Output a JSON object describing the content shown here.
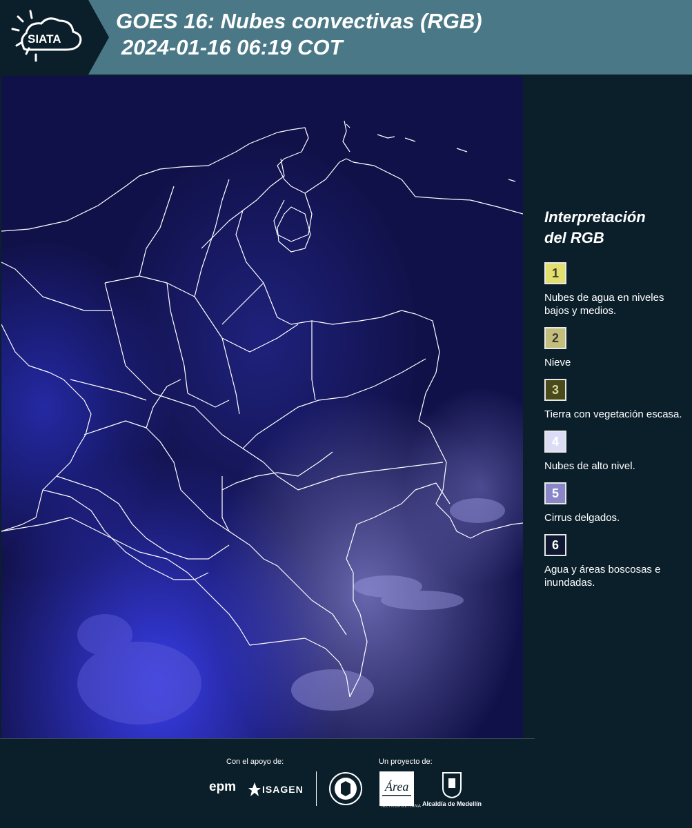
{
  "header": {
    "logo_text": "SIATA",
    "title_line1": "GOES 16: Nubes convectivas (RGB)",
    "title_line2": "2024-01-16 06:19 COT"
  },
  "legend": {
    "title_line1": "Interpretación",
    "title_line2": "del RGB",
    "items": [
      {
        "number": "1",
        "label": "Nubes de agua en niveles bajos y medios.",
        "color": "#e2df6c"
      },
      {
        "number": "2",
        "label": "Nieve",
        "color": "#c3bf7a"
      },
      {
        "number": "3",
        "label": "Tierra con vegetación escasa.",
        "color": "#4b4a1a"
      },
      {
        "number": "4",
        "label": "Nubes de alto nivel.",
        "color": "#dcdcf7"
      },
      {
        "number": "5",
        "label": "Cirrus delgados.",
        "color": "#8a87c9"
      },
      {
        "number": "6",
        "label": "Agua y áreas boscosas e inundadas.",
        "color": "#0f1731"
      }
    ]
  },
  "footer": {
    "support_caption": "Con el apoyo de:",
    "project_caption": "Un proyecto de:",
    "sponsors": [
      "epm",
      "ISAGEN"
    ],
    "partners": [
      "METROPOLITANA",
      "Alcaldía de Medellín"
    ]
  },
  "colors": {
    "header_bg": "#4a7886",
    "page_bg": "#0b1f2b",
    "map_bg": "#10124a",
    "border_lines": "#ffffff"
  }
}
